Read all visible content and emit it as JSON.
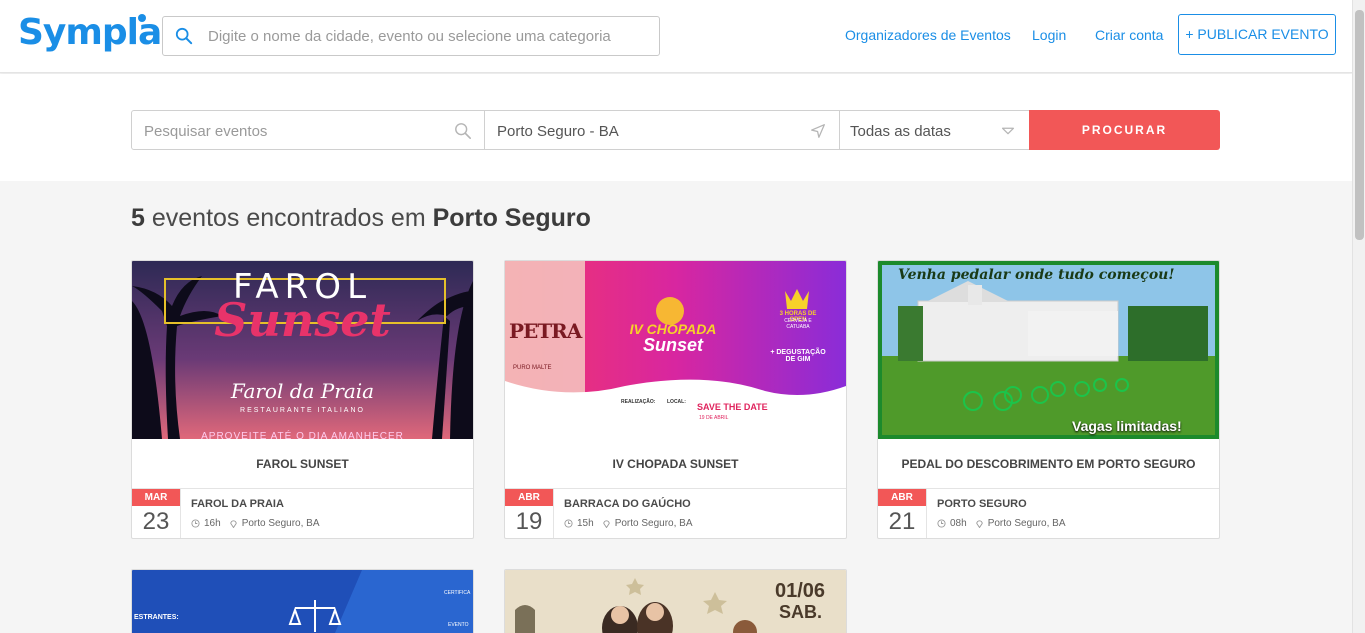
{
  "header": {
    "logo": "Sympla",
    "search_placeholder": "Digite o nome da cidade, evento ou selecione uma categoria",
    "nav": {
      "organizers": "Organizadores de Eventos",
      "login": "Login",
      "signup": "Criar conta",
      "publish": "+ PUBLICAR EVENTO"
    }
  },
  "search": {
    "events_placeholder": "Pesquisar eventos",
    "location_value": "Porto Seguro - BA",
    "dates_value": "Todas as datas",
    "submit": "PROCURAR"
  },
  "results": {
    "count": "5",
    "middle": "eventos encontrados em",
    "city": "Porto Seguro"
  },
  "events": [
    {
      "title": "FAROL SUNSET",
      "month": "MAR",
      "day": "23",
      "venue": "FAROL DA PRAIA",
      "time": "16h",
      "location": "Porto Seguro, BA",
      "image": {
        "headline": "FAROL",
        "script": "Sunset",
        "brand": "Farol da Praia",
        "brand_sub": "RESTAURANTE ITALIANO",
        "tagline": "APROVEITE ATÉ O DIA AMANHECER"
      }
    },
    {
      "title": "IV CHOPADA SUNSET",
      "month": "ABR",
      "day": "19",
      "venue": "BARRACA DO GAÚCHO",
      "time": "15h",
      "location": "Porto Seguro, BA",
      "image": {
        "bottle": "PETRA",
        "bottle_sub": "PURO MALTE",
        "title_line1": "IV CHOPADA",
        "title_line2": "Sunset",
        "extra": "+ DEGUSTAÇÃO DE GIM",
        "badge": "3 HORAS DE OPEN",
        "badge_sub": "CERVEJA E CATUABA",
        "credits": [
          "REALIZAÇÃO:",
          "LOCAL:"
        ],
        "save": "SAVE THE DATE",
        "save_date": "19 DE ABRIL"
      }
    },
    {
      "title": "PEDAL DO DESCOBRIMENTO EM PORTO SEGURO",
      "month": "ABR",
      "day": "21",
      "venue": "PORTO SEGURO",
      "time": "08h",
      "location": "Porto Seguro, BA",
      "image": {
        "top": "Venha pedalar onde tudo começou!",
        "bottom": "Vagas limitadas!"
      }
    }
  ],
  "partial_events": [
    {
      "image_text": [
        "ESTRANTES:",
        "CERTIFICA",
        "EVENTO"
      ]
    },
    {
      "image_text": [
        "01/06",
        "SAB."
      ]
    }
  ],
  "colors": {
    "brand": "#1a8ee6",
    "accent": "#f25757"
  }
}
